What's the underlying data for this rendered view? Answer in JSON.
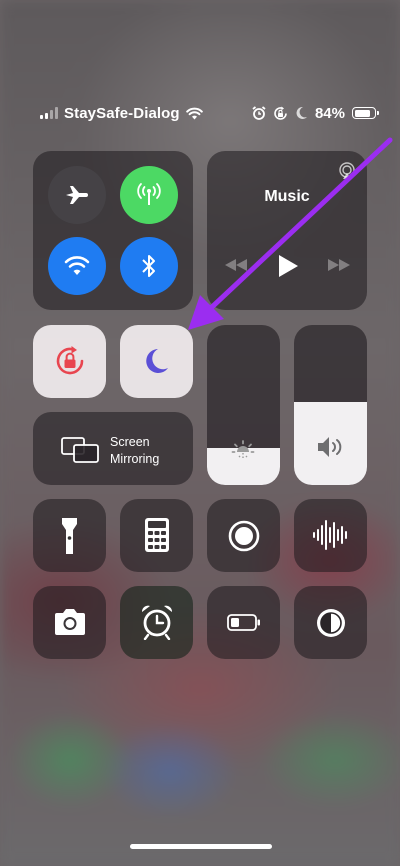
{
  "status_bar": {
    "carrier": "StaySafe-Dialog",
    "battery_percent": "84%",
    "battery_level": 0.84,
    "icons": [
      "signal-icon",
      "wifi-icon",
      "alarm-icon",
      "rotation-lock-icon",
      "moon-icon",
      "battery-icon"
    ]
  },
  "connectivity": {
    "airplane": {
      "icon": "airplane-icon",
      "state": "off"
    },
    "cellular": {
      "icon": "antenna-icon",
      "state": "on",
      "color": "#4cd964"
    },
    "wifi": {
      "icon": "wifi-icon",
      "state": "on",
      "color": "#1f7cf2"
    },
    "bluetooth": {
      "icon": "bluetooth-icon",
      "state": "on",
      "color": "#1f7cf2"
    }
  },
  "music": {
    "title": "Music",
    "controls": [
      "previous-icon",
      "play-icon",
      "next-icon"
    ]
  },
  "toggles": {
    "rotation_lock": {
      "icon": "rotation-lock-icon",
      "state": "on",
      "color": "#e8454f"
    },
    "do_not_disturb": {
      "icon": "moon-icon",
      "state": "on",
      "color": "#5b4fd6"
    }
  },
  "screen_mirroring": {
    "line1": "Screen",
    "line2": "Mirroring"
  },
  "brightness": {
    "level": 0.23
  },
  "volume": {
    "level": 0.52
  },
  "shortcuts": [
    "flashlight-icon",
    "calculator-icon",
    "screen-record-icon",
    "voice-memo-icon",
    "camera-icon",
    "alarm-icon",
    "low-power-icon",
    "dark-mode-icon"
  ],
  "annotation": {
    "color": "#9b2df0"
  }
}
